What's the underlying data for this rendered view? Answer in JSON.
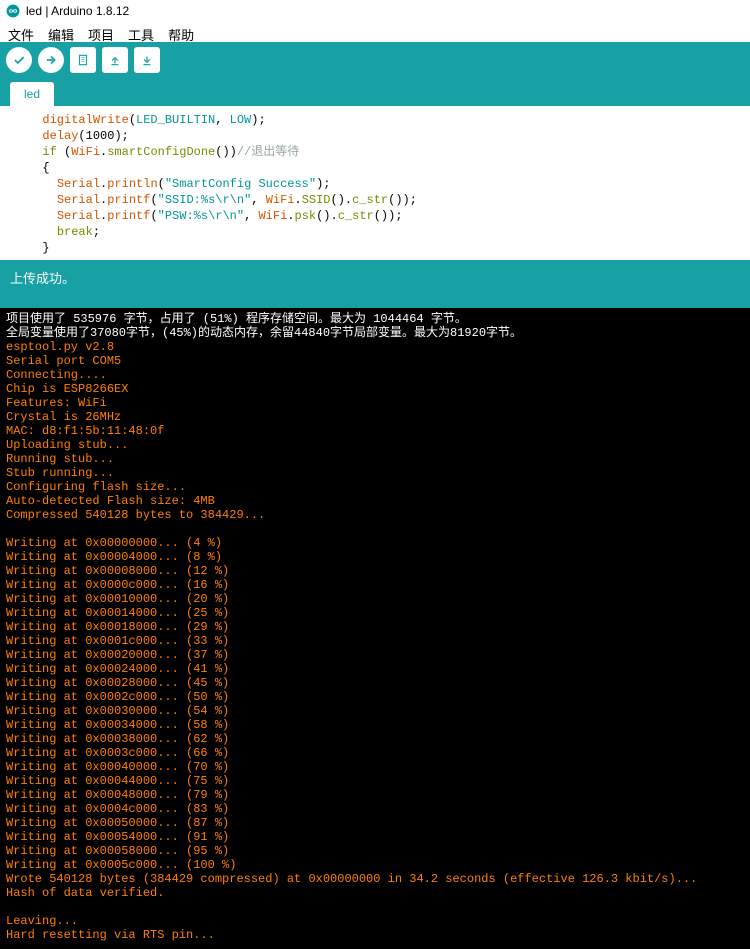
{
  "title": "led | Arduino 1.8.12",
  "menu": {
    "file": "文件",
    "edit": "编辑",
    "project": "项目",
    "tools": "工具",
    "help": "帮助"
  },
  "tab": {
    "name": "led"
  },
  "code": {
    "tokens": [
      {
        "t": "  ",
        "c": ""
      },
      {
        "t": "digitalWrite",
        "c": "fn"
      },
      {
        "t": "(",
        "c": ""
      },
      {
        "t": "LED_BUILTIN",
        "c": "const"
      },
      {
        "t": ", ",
        "c": ""
      },
      {
        "t": "LOW",
        "c": "const"
      },
      {
        "t": ");",
        "c": ""
      },
      {
        "nl": 1
      },
      {
        "t": "  ",
        "c": ""
      },
      {
        "t": "delay",
        "c": "fn"
      },
      {
        "t": "(",
        "c": ""
      },
      {
        "t": "1000",
        "c": "num"
      },
      {
        "t": ");",
        "c": ""
      },
      {
        "nl": 1
      },
      {
        "t": "  ",
        "c": ""
      },
      {
        "t": "if",
        "c": "type"
      },
      {
        "t": " (",
        "c": ""
      },
      {
        "t": "WiFi",
        "c": "kw"
      },
      {
        "t": ".",
        "c": ""
      },
      {
        "t": "smartConfigDone",
        "c": "method"
      },
      {
        "t": "())",
        "c": ""
      },
      {
        "t": "//退出等待",
        "c": "cm"
      },
      {
        "nl": 1
      },
      {
        "t": "  {",
        "c": ""
      },
      {
        "nl": 1
      },
      {
        "t": "    ",
        "c": ""
      },
      {
        "t": "Serial",
        "c": "kw"
      },
      {
        "t": ".",
        "c": ""
      },
      {
        "t": "println",
        "c": "fn"
      },
      {
        "t": "(",
        "c": ""
      },
      {
        "t": "\"SmartConfig Success\"",
        "c": "str"
      },
      {
        "t": ");",
        "c": ""
      },
      {
        "nl": 1
      },
      {
        "t": "    ",
        "c": ""
      },
      {
        "t": "Serial",
        "c": "kw"
      },
      {
        "t": ".",
        "c": ""
      },
      {
        "t": "printf",
        "c": "fn"
      },
      {
        "t": "(",
        "c": ""
      },
      {
        "t": "\"SSID:%s\\r\\n\"",
        "c": "str"
      },
      {
        "t": ", ",
        "c": ""
      },
      {
        "t": "WiFi",
        "c": "kw"
      },
      {
        "t": ".",
        "c": ""
      },
      {
        "t": "SSID",
        "c": "method"
      },
      {
        "t": "().",
        "c": ""
      },
      {
        "t": "c_str",
        "c": "method"
      },
      {
        "t": "());",
        "c": ""
      },
      {
        "nl": 1
      },
      {
        "t": "    ",
        "c": ""
      },
      {
        "t": "Serial",
        "c": "kw"
      },
      {
        "t": ".",
        "c": ""
      },
      {
        "t": "printf",
        "c": "fn"
      },
      {
        "t": "(",
        "c": ""
      },
      {
        "t": "\"PSW:%s\\r\\n\"",
        "c": "str"
      },
      {
        "t": ", ",
        "c": ""
      },
      {
        "t": "WiFi",
        "c": "kw"
      },
      {
        "t": ".",
        "c": ""
      },
      {
        "t": "psk",
        "c": "method"
      },
      {
        "t": "().",
        "c": ""
      },
      {
        "t": "c_str",
        "c": "method"
      },
      {
        "t": "());",
        "c": ""
      },
      {
        "nl": 1
      },
      {
        "t": "    ",
        "c": ""
      },
      {
        "t": "break",
        "c": "type"
      },
      {
        "t": ";",
        "c": ""
      },
      {
        "nl": 1
      },
      {
        "t": "  }",
        "c": ""
      }
    ]
  },
  "status": {
    "msg": "上传成功。"
  },
  "console": {
    "white": [
      "项目使用了 535976 字节，占用了 (51%) 程序存储空间。最大为 1044464 字节。",
      "全局变量使用了37080字节，(45%)的动态内存，余留44840字节局部变量。最大为81920字节。"
    ],
    "lines": [
      "esptool.py v2.8",
      "Serial port COM5",
      "Connecting....",
      "Chip is ESP8266EX",
      "Features: WiFi",
      "Crystal is 26MHz",
      "MAC: d8:f1:5b:11:48:0f",
      "Uploading stub...",
      "Running stub...",
      "Stub running...",
      "Configuring flash size...",
      "Auto-detected Flash size: 4MB",
      "Compressed 540128 bytes to 384429...",
      "",
      "Writing at 0x00000000... (4 %)",
      "Writing at 0x00004000... (8 %)",
      "Writing at 0x00008000... (12 %)",
      "Writing at 0x0000c000... (16 %)",
      "Writing at 0x00010000... (20 %)",
      "Writing at 0x00014000... (25 %)",
      "Writing at 0x00018000... (29 %)",
      "Writing at 0x0001c000... (33 %)",
      "Writing at 0x00020000... (37 %)",
      "Writing at 0x00024000... (41 %)",
      "Writing at 0x00028000... (45 %)",
      "Writing at 0x0002c000... (50 %)",
      "Writing at 0x00030000... (54 %)",
      "Writing at 0x00034000... (58 %)",
      "Writing at 0x00038000... (62 %)",
      "Writing at 0x0003c000... (66 %)",
      "Writing at 0x00040000... (70 %)",
      "Writing at 0x00044000... (75 %)",
      "Writing at 0x00048000... (79 %)",
      "Writing at 0x0004c000... (83 %)",
      "Writing at 0x00050000... (87 %)",
      "Writing at 0x00054000... (91 %)",
      "Writing at 0x00058000... (95 %)",
      "Writing at 0x0005c000... (100 %)",
      "Wrote 540128 bytes (384429 compressed) at 0x00000000 in 34.2 seconds (effective 126.3 kbit/s)...",
      "Hash of data verified.",
      "",
      "Leaving...",
      "Hard resetting via RTS pin..."
    ]
  }
}
